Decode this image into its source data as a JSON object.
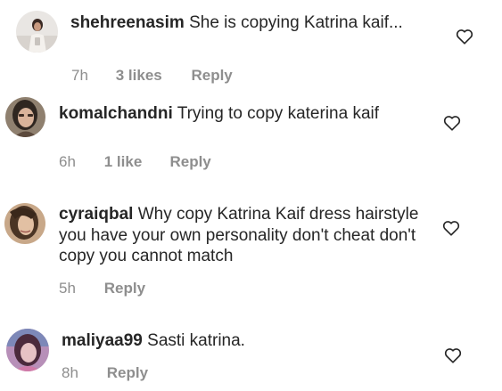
{
  "comments": [
    {
      "username": "shehreenasim",
      "text": "She is copying Katrina kaif...",
      "time": "7h",
      "likes": "3 likes",
      "reply": "Reply",
      "avatar_icon": "avatar-photo"
    },
    {
      "username": "komalchandni",
      "text": "Trying to copy katerina kaif",
      "time": "6h",
      "likes": "1 like",
      "reply": "Reply",
      "avatar_icon": "avatar-photo"
    },
    {
      "username": "cyraiqbal",
      "text": "Why copy Katrina Kaif dress hairstyle you have your own personality don't cheat don't copy you cannot match",
      "time": "5h",
      "likes": "",
      "reply": "Reply",
      "avatar_icon": "avatar-photo"
    },
    {
      "username": "maliyaa99",
      "text": "Sasti katrina.",
      "time": "8h",
      "likes": "",
      "reply": "Reply",
      "avatar_icon": "avatar-photo"
    }
  ],
  "icons": {
    "like": "heart-outline-icon"
  },
  "colors": {
    "text": "#262626",
    "meta": "#8e8e8e",
    "heart_stroke": "#262626"
  }
}
